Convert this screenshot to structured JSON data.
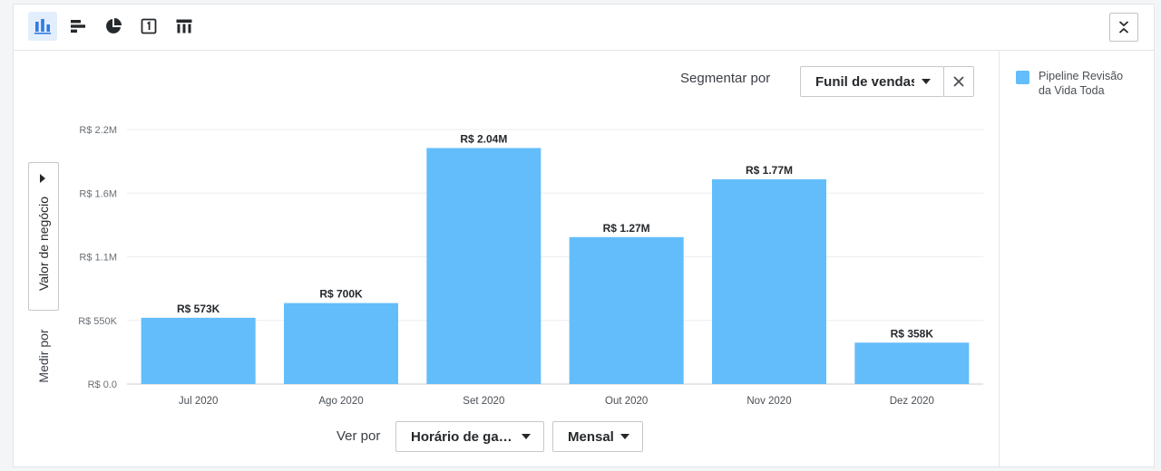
{
  "toolbar": {
    "chart_type_buttons": [
      {
        "name": "column-chart-icon",
        "active": true
      },
      {
        "name": "bar-chart-icon",
        "active": false
      },
      {
        "name": "pie-chart-icon",
        "active": false
      },
      {
        "name": "single-value-icon",
        "active": false
      },
      {
        "name": "table-icon",
        "active": false
      }
    ],
    "collapse_icon": "collapse-icon"
  },
  "segment": {
    "label": "Segmentar por",
    "value": "Funil de vendas"
  },
  "measure": {
    "label": "Medir por",
    "value": "Valor de negócio"
  },
  "view": {
    "label": "Ver por",
    "field": "Horário de ga…",
    "interval": "Mensal"
  },
  "legend": [
    {
      "label": "Pipeline Revisão da Vida Toda",
      "color": "#63bdfb"
    }
  ],
  "chart_data": {
    "type": "bar",
    "categories": [
      "Jul 2020",
      "Ago 2020",
      "Set 2020",
      "Out 2020",
      "Nov 2020",
      "Dez 2020"
    ],
    "series": [
      {
        "name": "Pipeline Revisão da Vida Toda",
        "values": [
          573000,
          700000,
          2040000,
          1270000,
          1770000,
          358000
        ],
        "color": "#63bdfb"
      }
    ],
    "data_labels": [
      "R$ 573K",
      "R$ 700K",
      "R$ 2.04M",
      "R$ 1.27M",
      "R$ 1.77M",
      "R$ 358K"
    ],
    "y_ticks": [
      {
        "value": 0,
        "label": "R$ 0.0"
      },
      {
        "value": 550000,
        "label": "R$ 550K"
      },
      {
        "value": 1100000,
        "label": "R$ 1.1M"
      },
      {
        "value": 1650000,
        "label": "R$ 1.6M"
      },
      {
        "value": 2200000,
        "label": "R$ 2.2M"
      }
    ],
    "ylim": [
      0,
      2200000
    ],
    "grid": true
  }
}
